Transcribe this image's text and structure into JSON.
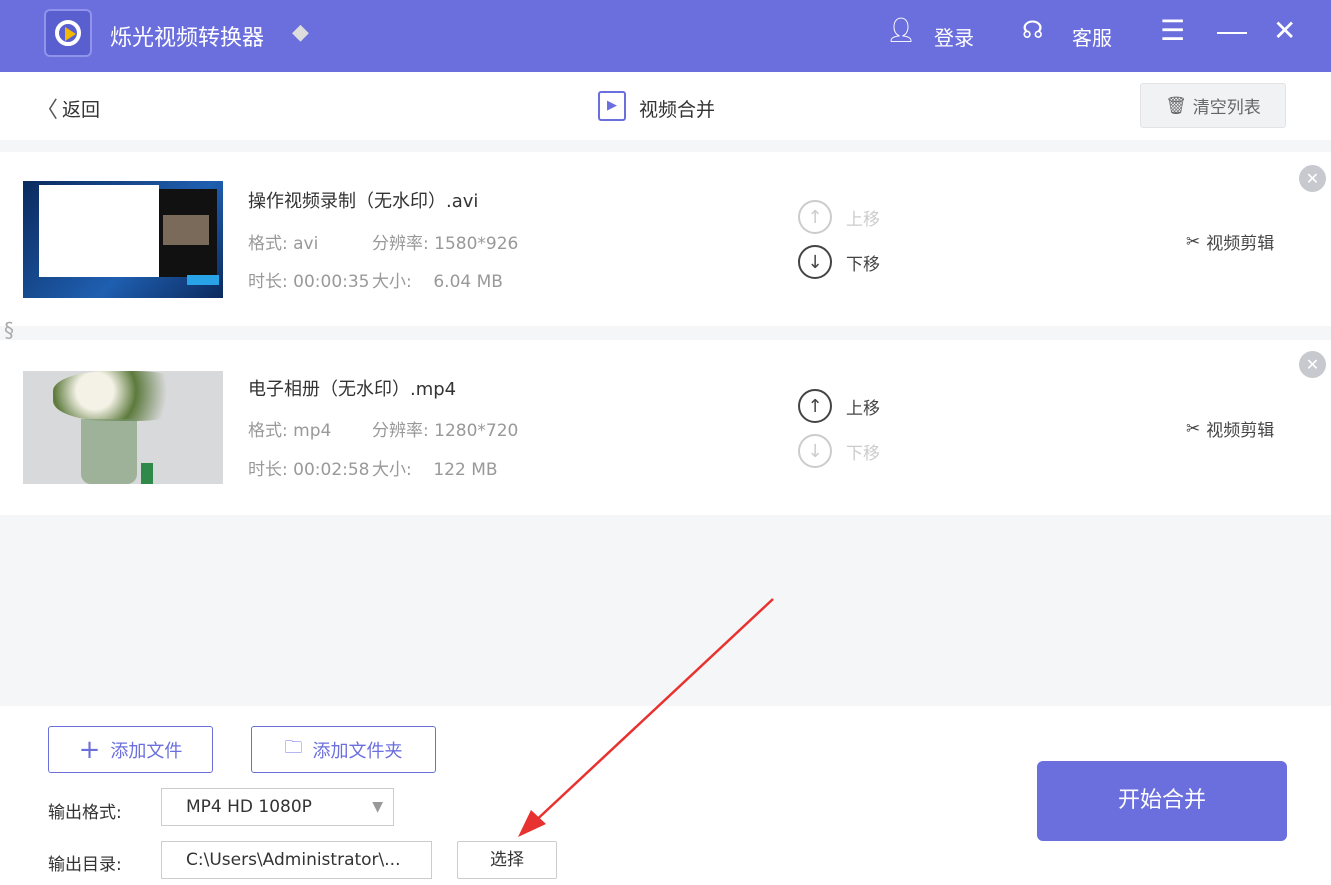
{
  "app": {
    "title": "烁光视频转换器",
    "login": "登录",
    "support": "客服"
  },
  "toolbar": {
    "back": "返回",
    "page_title": "视频合并",
    "clear": "清空列表"
  },
  "files": [
    {
      "name": "操作视频录制（无水印）.avi",
      "format_label": "格式:",
      "format": "avi",
      "res_label": "分辨率:",
      "resolution": "1580*926",
      "dur_label": "时长:",
      "duration": "00:00:35",
      "size_label": "大小:",
      "size": "6.04 MB",
      "up": "上移",
      "down": "下移",
      "edit": "视频剪辑"
    },
    {
      "name": "电子相册（无水印）.mp4",
      "format_label": "格式:",
      "format": "mp4",
      "res_label": "分辨率:",
      "resolution": "1280*720",
      "dur_label": "时长:",
      "duration": "00:02:58",
      "size_label": "大小:",
      "size": "122 MB",
      "up": "上移",
      "down": "下移",
      "edit": "视频剪辑"
    }
  ],
  "bottom": {
    "add_file": "添加文件",
    "add_folder": "添加文件夹",
    "format_label": "输出格式:",
    "format_value": "MP4 HD 1080P",
    "dir_label": "输出目录:",
    "dir_value": "C:\\Users\\Administrator\\...",
    "choose": "选择",
    "start": "开始合并"
  },
  "colors": {
    "accent": "#6b6fdd",
    "annotation": "#e8322f"
  }
}
